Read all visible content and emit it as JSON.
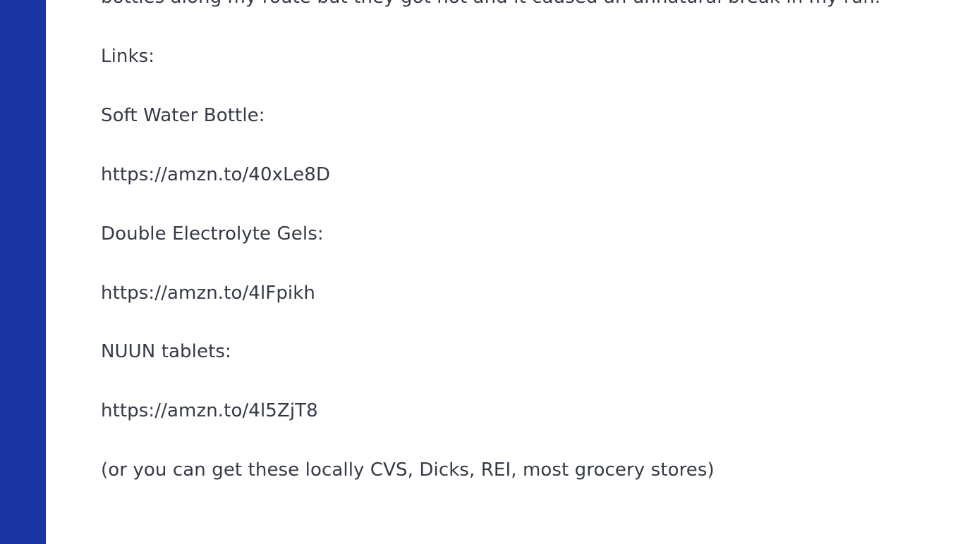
{
  "article": {
    "partial_top_line": "bottles along my route but they got hot and it caused an unnatural break in my run.",
    "links_heading": "Links:",
    "items": [
      {
        "label": "Soft Water Bottle:",
        "url": "https://amzn.to/40xLe8D"
      },
      {
        "label": "Double Electrolyte Gels:",
        "url": "https://amzn.to/4lFpikh"
      },
      {
        "label": "NUUN tablets:",
        "url": "https://amzn.to/4l5ZjT8"
      }
    ],
    "footer_note": "(or you can get these locally CVS, Dicks, REI, most grocery stores)"
  },
  "colors": {
    "sidebar": "#1a35a3",
    "text": "#353a47",
    "background": "#ffffff"
  }
}
